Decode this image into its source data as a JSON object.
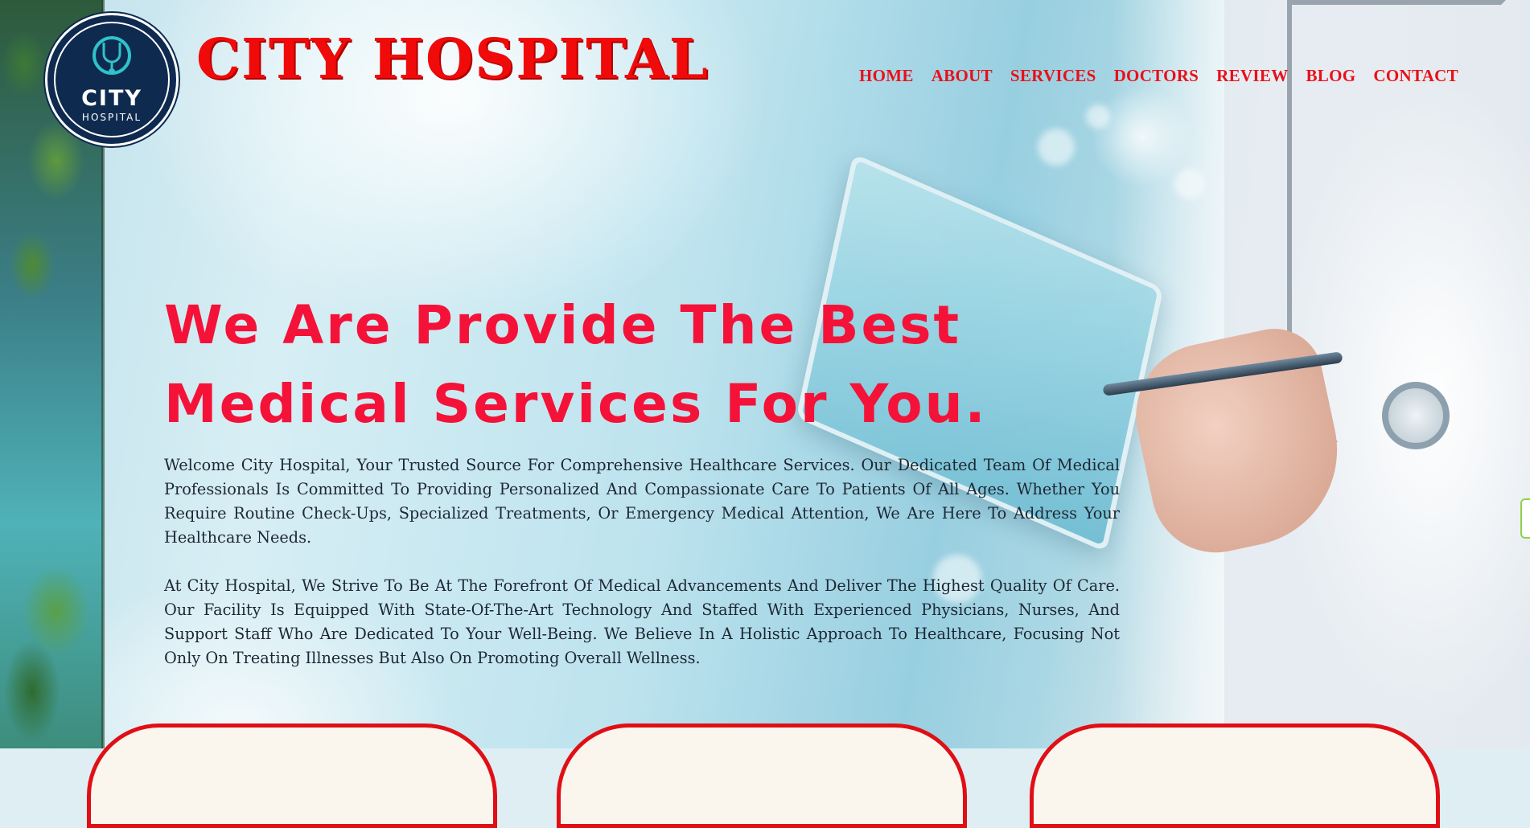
{
  "logo": {
    "word1": "CITY",
    "word2": "HOSPITAL",
    "icon": "stethoscope-icon"
  },
  "brand": {
    "title": "CITY HOSPITAL"
  },
  "nav": {
    "items": [
      "HOME",
      "ABOUT",
      "SERVICES",
      "DOCTORS",
      "REVIEW",
      "BLOG",
      "CONTACT"
    ]
  },
  "hero": {
    "title": "We Are Provide The Best Medical Services For You.",
    "paragraph1": "Welcome City Hospital, Your Trusted Source For Comprehensive Healthcare Services. Our Dedicated Team Of Medical Professionals Is Committed To Providing Personalized And Compassionate Care To Patients Of All Ages. Whether You Require Routine Check-Ups, Specialized Treatments, Or Emergency Medical Attention, We Are Here To Address Your Healthcare Needs.",
    "paragraph2": "At City Hospital, We Strive To Be At The Forefront Of Medical Advancements And Deliver The Highest Quality Of Care. Our Facility Is Equipped With State-Of-The-Art Technology And Staffed With Experienced Physicians, Nurses, And Support Staff Who Are Dedicated To Your Well-Being. We Believe In A Holistic Approach To Healthcare, Focusing Not Only On Treating Illnesses But Also On Promoting Overall Wellness."
  },
  "colors": {
    "brand_red": "#f00a0a",
    "nav_red": "#e8101a",
    "hero_title": "#f41238",
    "logo_navy": "#0f2a4f",
    "card_border": "#e00f16"
  }
}
